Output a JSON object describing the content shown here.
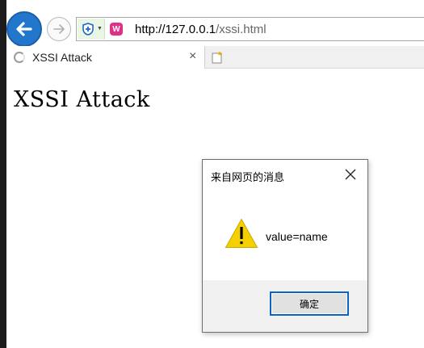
{
  "browser": {
    "url": {
      "host": "http://127.0.0.1",
      "path": "/xssi.html"
    },
    "tab": {
      "title": "XSSI Attack",
      "close_glyph": "×"
    },
    "site_icon_glyph": "W",
    "icons": {
      "back": "back-arrow-icon",
      "forward": "forward-arrow-icon",
      "security": "shield-icon",
      "site": "site-favicon-icon",
      "new_tab": "new-tab-icon",
      "loading": "loading-spinner-icon"
    },
    "accent_color": "#2277cc"
  },
  "page": {
    "heading": "XSSI Attack"
  },
  "dialog": {
    "title": "来自网页的消息",
    "message": "value=name",
    "ok_label": "确定",
    "icons": {
      "close": "close-icon",
      "warning": "warning-icon"
    },
    "warning_color": "#f5d000"
  }
}
